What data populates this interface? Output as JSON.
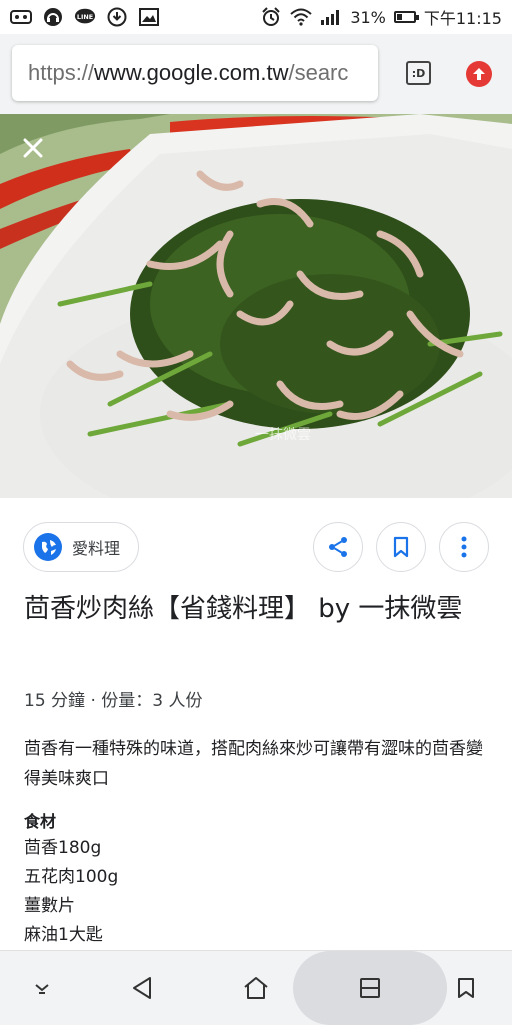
{
  "status_bar": {
    "battery_percent": "31%",
    "time": "下午11:15",
    "battery_level": 0.31,
    "left_icons": [
      "voicemail-icon",
      "headset-icon",
      "line-app-icon",
      "download-icon",
      "image-icon"
    ],
    "right_icons": [
      "alarm-icon",
      "wifi-icon",
      "signal-icon",
      "battery-icon"
    ]
  },
  "address_bar": {
    "url_scheme": "https://",
    "url_host": "www.google.com.tw",
    "url_rest": "/searc",
    "tab_label": ":D"
  },
  "source": {
    "name": "愛料理"
  },
  "recipe": {
    "title": "茴香炒肉絲【省錢料理】 by 一抹微雲",
    "meta": "15 分鐘 · 份量：3 人份",
    "description": "茴香有一種特殊的味道，搭配肉絲來炒可讓帶有澀味的茴香變得美味爽口",
    "ingredients_heading": "食材",
    "ingredients": [
      "茴香180g",
      "五花肉100g",
      "薑數片",
      "麻油1大匙"
    ],
    "watermark": "一抹微雲"
  },
  "colors": {
    "accent_blue": "#1a73e8",
    "upload_red": "#e53935",
    "toolbar_bg": "#f1f3f4"
  }
}
